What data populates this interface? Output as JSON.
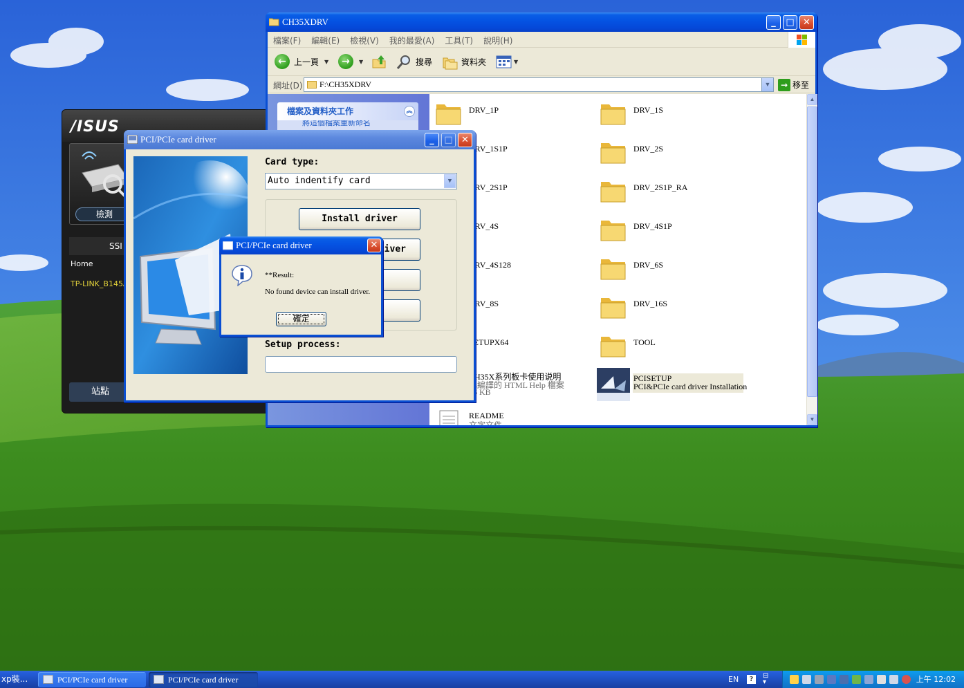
{
  "explorer": {
    "title": "CH35XDRV",
    "menus": [
      "檔案(F)",
      "編輯(E)",
      "檢視(V)",
      "我的最愛(A)",
      "工具(T)",
      "說明(H)"
    ],
    "toolbar": {
      "back": "上一頁",
      "search": "搜尋",
      "folders": "資料夾"
    },
    "address_label": "網址(D)",
    "address_value": "F:\\CH35XDRV",
    "go_label": "移至",
    "taskpane": {
      "header": "檔案及資料夾工作",
      "link": "將這個檔案重新命名"
    },
    "files": [
      {
        "name": "DRV_1P"
      },
      {
        "name": "DRV_1S"
      },
      {
        "name": "DRV_1S1P"
      },
      {
        "name": "DRV_2S"
      },
      {
        "name": "DRV_2S1P"
      },
      {
        "name": "DRV_2S1P_RA"
      },
      {
        "name": "DRV_4S"
      },
      {
        "name": "DRV_4S1P"
      },
      {
        "name": "DRV_4S128"
      },
      {
        "name": "DRV_6S"
      },
      {
        "name": "DRV_8S"
      },
      {
        "name": "DRV_16S"
      },
      {
        "name": "SETUPX64"
      },
      {
        "name": "TOOL"
      },
      {
        "name": "CH35X系列板卡使用说明",
        "type": "已編譯的 HTML Help 檔案",
        "size": "36 KB"
      },
      {
        "name": "PCISETUP",
        "type": "PCI&PCIe card driver Installation"
      },
      {
        "name": "README",
        "type": "文字文件"
      }
    ]
  },
  "asus": {
    "logo": "/ISUS",
    "detect_label": "檢測",
    "ssid_label": "SSI",
    "home_label": "Home",
    "network_name": "TP-LINK_B145A",
    "site_label": "站點"
  },
  "driver": {
    "title": "PCI/PCIe card driver",
    "card_type_label": "Card type:",
    "card_type_value": "Auto indentify card",
    "install_label": "Install driver",
    "uninstall_label": "Uninstall driver",
    "setup_process_label": "Setup process:"
  },
  "msgbox": {
    "title": "PCI/PCIe card driver",
    "line1": "**Result:",
    "line2": "No found device can install driver.",
    "ok_label": "確定"
  },
  "taskbar": {
    "start_label": "xp裝...",
    "tasks": [
      "PCI/PCIe card driver",
      "PCI/PCIe card driver"
    ],
    "lang": "EN",
    "clock": "上午 12:02"
  },
  "colors": {
    "xp_blue": "#0554e3",
    "tray": "#1185d8",
    "asus_yellow": "#e3d23a"
  }
}
